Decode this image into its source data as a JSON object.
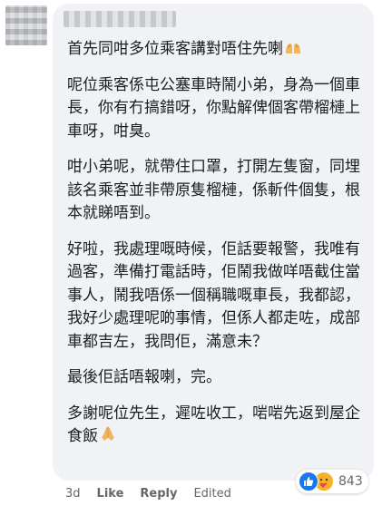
{
  "comment": {
    "paragraphs": [
      "首先同咁多位乘客講對唔住先喇",
      "呢位乘客係屯公塞車時鬧小弟，身為一個車長，你有冇搞錯呀，你點解俾個客帶榴槤上車呀，咁臭。",
      "咁小弟呢，就帶住口罩，打開左隻窗，同埋該名乘客並非帶原隻榴槤，係斬件個隻，根本就睇唔到。",
      "好啦，我處理嘅時候，佢話要報警，我唯有過客，準備打電話時，佢鬧我做咩唔截住當事人，鬧我唔係一個稱職嘅車長，我都認，我好少處理呢啲事情，但係人都走咗，成部車都吉左，我問佢，滿意未？",
      "最後佢話唔報喇，完。",
      "多謝呢位先生，遲咗收工，啱啱先返到屋企食飯"
    ],
    "paragraph_emojis": [
      "hands-emoji",
      "",
      "",
      "",
      "",
      "folded-hands-emoji"
    ]
  },
  "footer": {
    "time": "3d",
    "like_label": "Like",
    "reply_label": "Reply",
    "edited_label": "Edited"
  },
  "reactions": {
    "count": "843",
    "types": [
      "like",
      "care"
    ],
    "colors": {
      "like": "#1877f2",
      "care": "#f7b125"
    }
  }
}
